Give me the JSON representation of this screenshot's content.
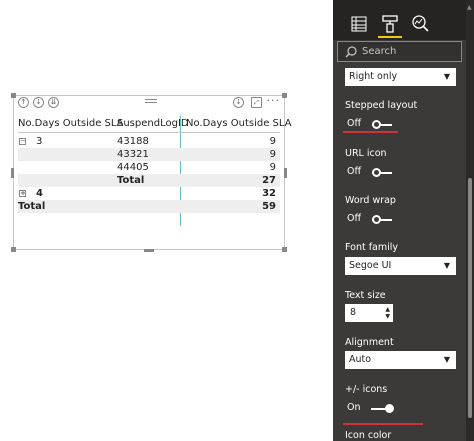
{
  "matrix": {
    "headers": [
      "No.Days Outside SLA",
      "SuspendLogID",
      "No.Days Outside SLA"
    ],
    "rows": [
      {
        "exp": "−",
        "c1": "3",
        "c2": "43188",
        "c3": "9"
      },
      {
        "exp": "",
        "c1": "",
        "c2": "43321",
        "c3": "9"
      },
      {
        "exp": "",
        "c1": "",
        "c2": "44405",
        "c3": "9"
      },
      {
        "exp": "",
        "c1": "",
        "c2": "Total",
        "c3": "27"
      },
      {
        "exp": "+",
        "c1": "4",
        "c2": "",
        "c3": "32"
      },
      {
        "exp": "",
        "c1": "Total",
        "c2": "",
        "c3": "59"
      }
    ]
  },
  "pane": {
    "search_placeholder": "Search",
    "row_header_position": "Right only",
    "stepped_layout": {
      "label": "Stepped layout",
      "state": "Off"
    },
    "url_icon": {
      "label": "URL icon",
      "state": "Off"
    },
    "word_wrap": {
      "label": "Word wrap",
      "state": "Off"
    },
    "font_family": {
      "label": "Font family",
      "value": "Segoe UI"
    },
    "text_size": {
      "label": "Text size",
      "value": "8"
    },
    "alignment": {
      "label": "Alignment",
      "value": "Auto"
    },
    "plus_minus_icons": {
      "label": "+/- icons",
      "state": "On"
    },
    "icon_color": {
      "label": "Icon color"
    }
  },
  "colors": {
    "accent": "#f2c811",
    "pane_bg": "#3b3a39",
    "highlight": "#d13438",
    "column_sep": "#5fc4be"
  }
}
